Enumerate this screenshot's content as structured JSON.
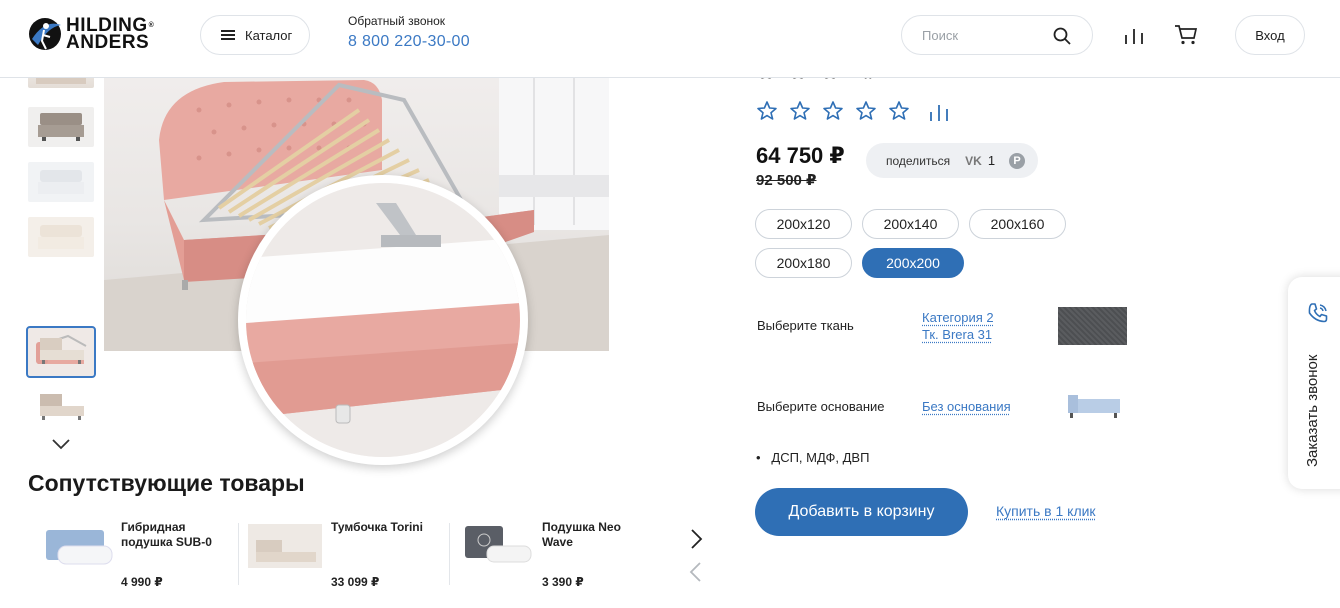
{
  "header": {
    "brand_line1": "HILDING",
    "brand_line2": "ANDERS",
    "catalog_label": "Каталог",
    "callback_label": "Обратный звонок",
    "phone": "8 800 220-30-00",
    "search_placeholder": "Поиск",
    "login_label": "Вход"
  },
  "gallery": {
    "thumbnail_count": 7,
    "selected_thumbnail": 5
  },
  "related": {
    "title": "Сопутствующие товары",
    "items": [
      {
        "name": "Гибридная подушка SUB-0",
        "price": "4 990 ₽"
      },
      {
        "name": "Тумбочка Torini",
        "price": "33 099 ₽"
      },
      {
        "name": "Подушка Neo Wave",
        "price": "3 390 ₽"
      }
    ]
  },
  "product": {
    "rating_stars": 5,
    "rating_value": 0,
    "price": "64 750 ₽",
    "old_price": "92 500 ₽",
    "share_label": "поделиться",
    "vk_label": "VK",
    "vk_count": "1",
    "sizes": [
      "200x120",
      "200x140",
      "200x160",
      "200x180",
      "200x200"
    ],
    "selected_size": "200x200",
    "fabric_label": "Выберите ткань",
    "fabric_value_line1": "Категория 2",
    "fabric_value_line2": "Тк. Brera 31",
    "base_label": "Выберите основание",
    "base_value": "Без основания",
    "material": "ДСП, МДФ, ДВП",
    "add_to_cart": "Добавить в корзину",
    "buy_one_click": "Купить в 1 клик"
  },
  "side_widget": {
    "label": "Заказать звонок"
  },
  "colors": {
    "accent": "#2f6fb5",
    "link": "#3b79c4",
    "upholstery": "#e8a8a0"
  }
}
